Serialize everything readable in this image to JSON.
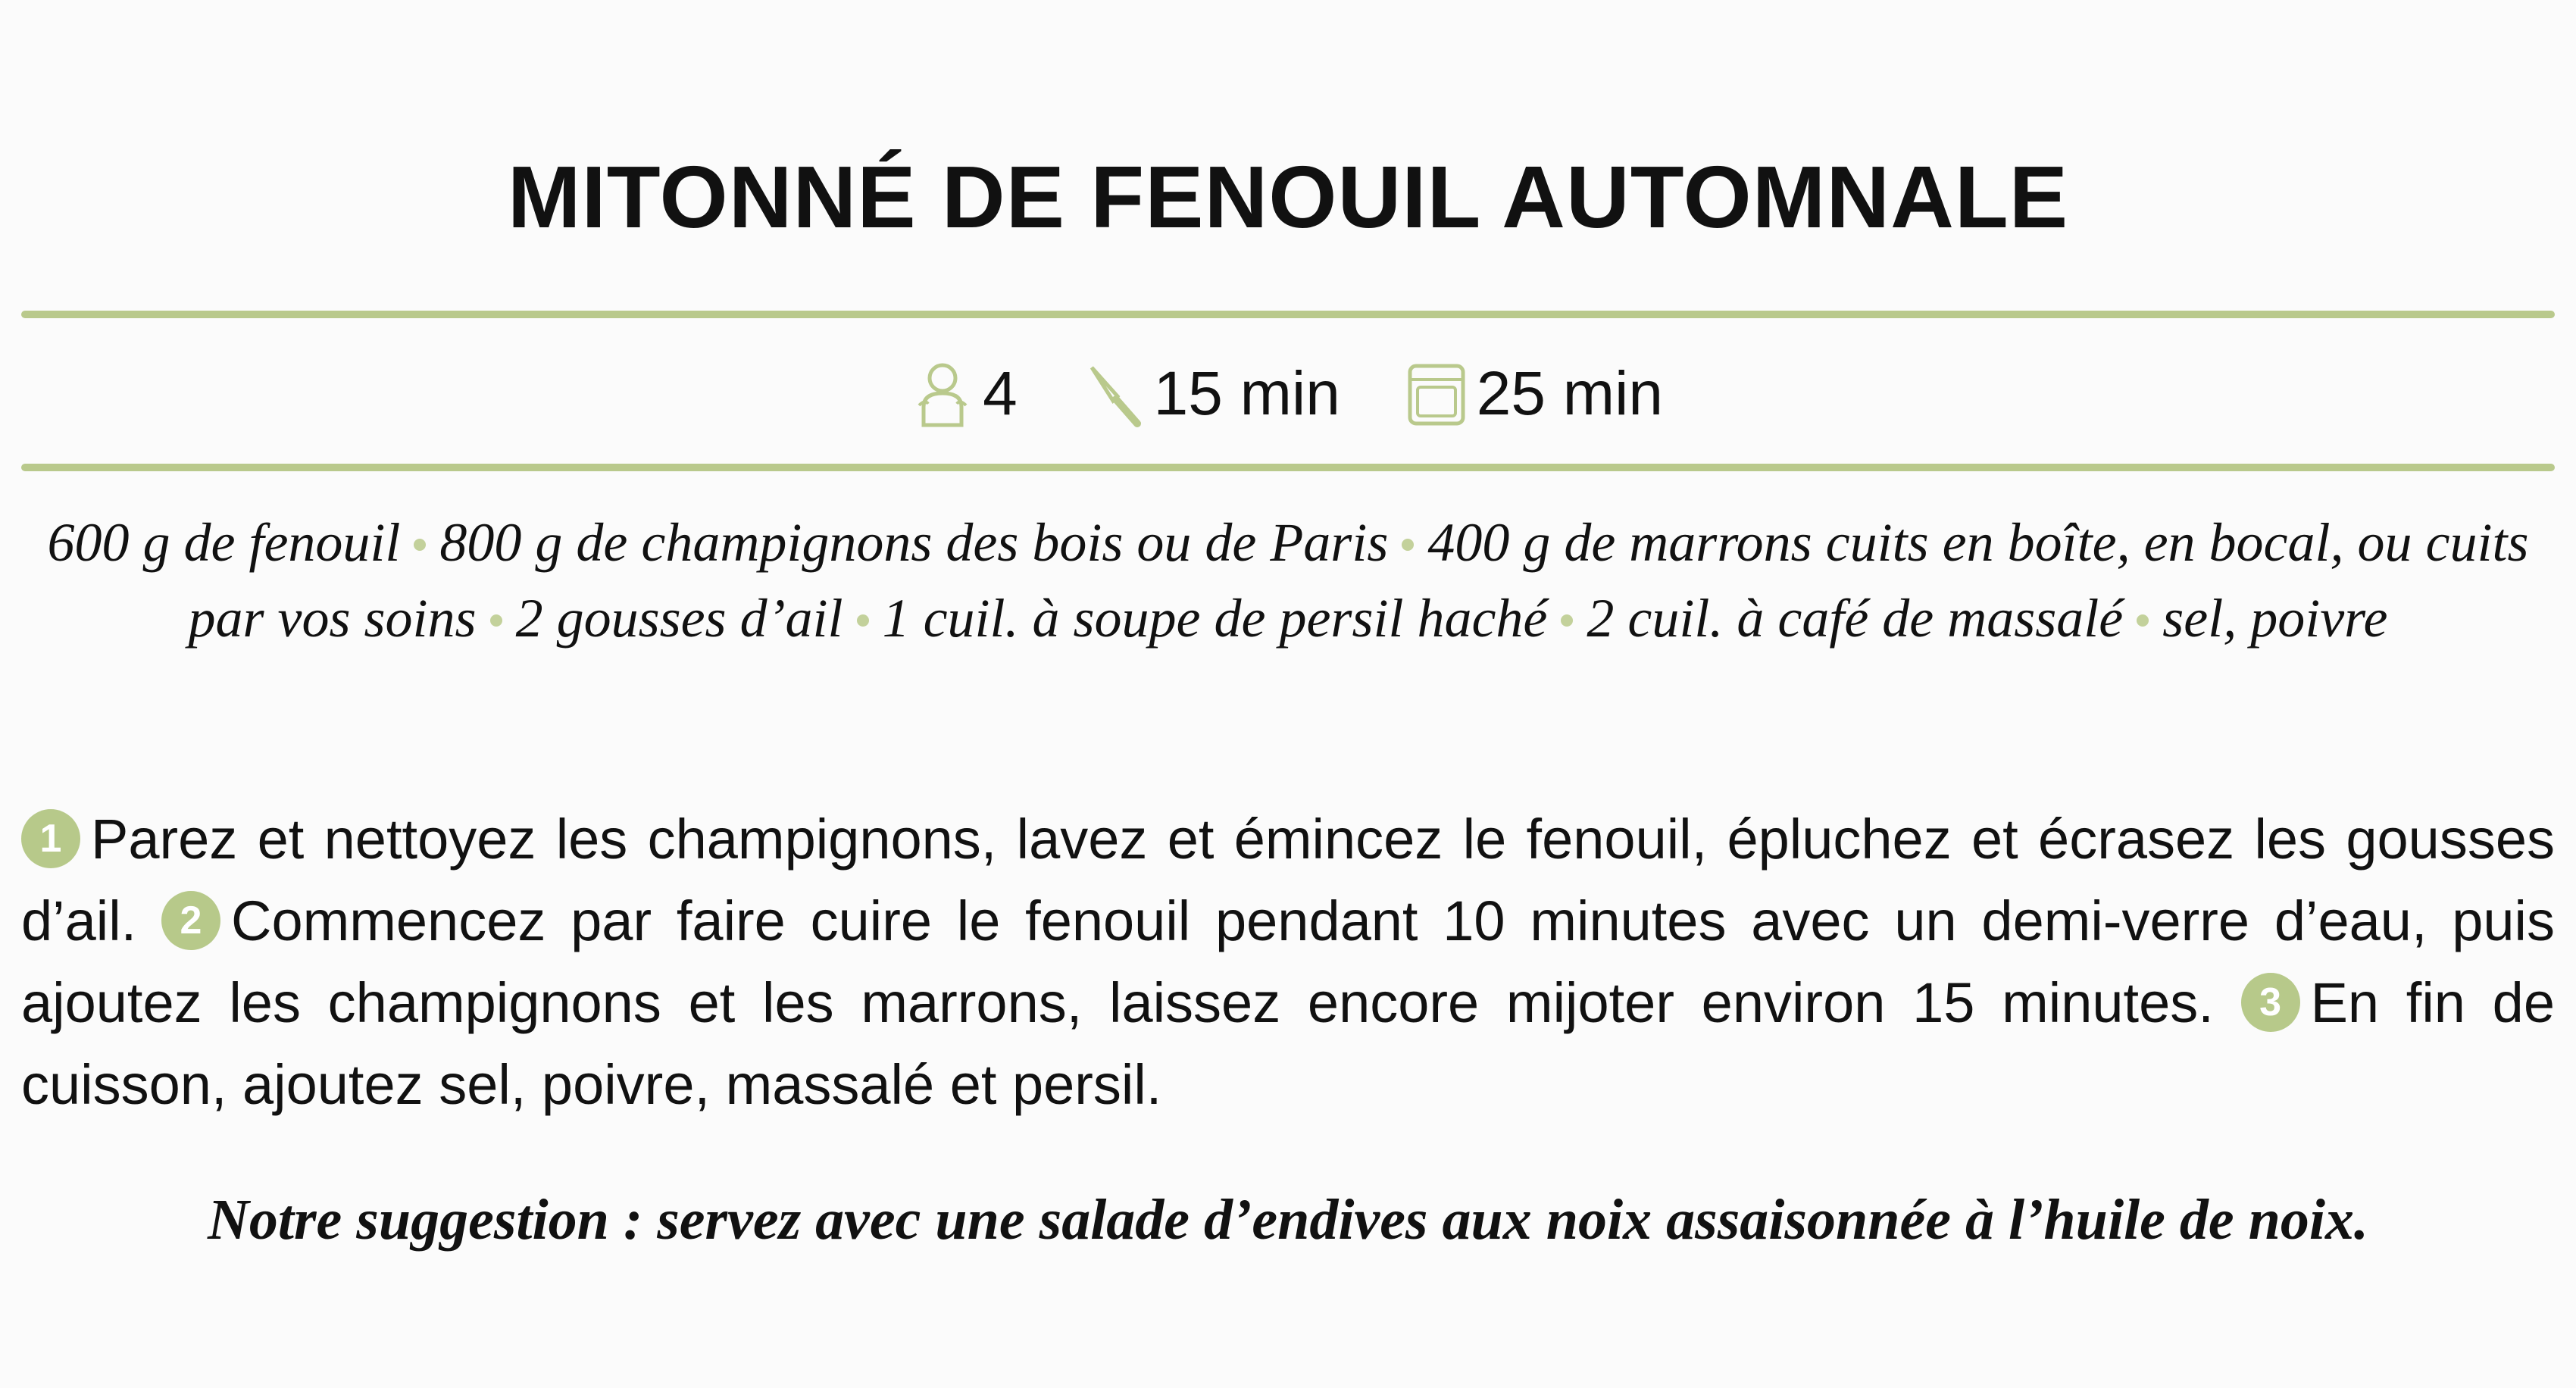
{
  "title": "MITONNÉ DE FENOUIL AUTOMNALE",
  "meta": {
    "servings": {
      "icon": "person-icon",
      "value": "4"
    },
    "prep_time": {
      "icon": "knife-icon",
      "value": "15 min"
    },
    "cook_time": {
      "icon": "oven-icon",
      "value": "25 min"
    }
  },
  "ingredients": [
    "600 g de fenouil",
    "800 g de champignons des bois ou de Paris",
    "400 g de marrons cuits en boîte, en bocal, ou cuits par vos soins",
    "2 gousses d’ail",
    "1 cuil. à soupe de persil haché",
    "2 cuil. à café de massalé",
    "sel, poivre"
  ],
  "steps": [
    {
      "number": "1",
      "text": "Parez et nettoyez les champignons, lavez et émincez le fenouil, épluchez et écrasez les gousses d’ail."
    },
    {
      "number": "2",
      "text": "Commencez par faire cuire le fenouil pendant 10 minutes avec un demi-verre d’eau, puis ajoutez les champignons et les marrons, laissez encore mijoter environ 15 minutes."
    },
    {
      "number": "3",
      "text": "En fin de cuisson, ajoutez sel, poivre, massalé et persil."
    }
  ],
  "suggestion": "Notre suggestion : servez avec une salade d’endives aux noix assaisonnée à l’huile de noix.",
  "colors": {
    "accent": "#b9c98c",
    "badge": "#b7c98a",
    "separator": "#c3d19b",
    "text": "#111111",
    "background": "#fbfbfb"
  }
}
